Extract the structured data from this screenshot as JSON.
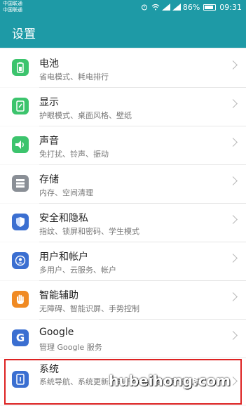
{
  "status_bar": {
    "carrier1": "中国联通",
    "carrier2": "中国联通",
    "battery_text": "86%",
    "time": "09:31",
    "icons": [
      "alarm-icon",
      "wifi-icon",
      "signal-icon",
      "battery-icon"
    ]
  },
  "app_bar": {
    "title": "设置"
  },
  "items": [
    {
      "title": "电池",
      "subtitle": "省电模式、耗电排行",
      "icon": "battery-icon",
      "color": "#3cc46d"
    },
    {
      "title": "显示",
      "subtitle": "护眼模式、桌面风格、壁纸",
      "icon": "display-icon",
      "color": "#3cc46d"
    },
    {
      "title": "声音",
      "subtitle": "免打扰、铃声、振动",
      "icon": "sound-icon",
      "color": "#3cc46d"
    },
    {
      "title": "存储",
      "subtitle": "内存、空间清理",
      "icon": "storage-icon",
      "color": "#8a8f96"
    },
    {
      "title": "安全和隐私",
      "subtitle": "指纹、锁屏和密码、学生模式",
      "icon": "shield-icon",
      "color": "#3b6fd1"
    },
    {
      "title": "用户和帐户",
      "subtitle": "多用户、云服务、帐户",
      "icon": "user-icon",
      "color": "#3b6fd1"
    },
    {
      "title": "智能辅助",
      "subtitle": "无障碍、智能识屏、手势控制",
      "icon": "hand-icon",
      "color": "#f08a23"
    },
    {
      "title": "Google",
      "subtitle": "管理 Google 服务",
      "icon": "google-icon",
      "color": "#3b6fd1"
    },
    {
      "title": "系统",
      "subtitle": "系统导航、系统更新、关于手机、语言和输入法",
      "icon": "system-icon",
      "color": "#3b6fd1"
    }
  ],
  "watermark": "hubeihong.com"
}
